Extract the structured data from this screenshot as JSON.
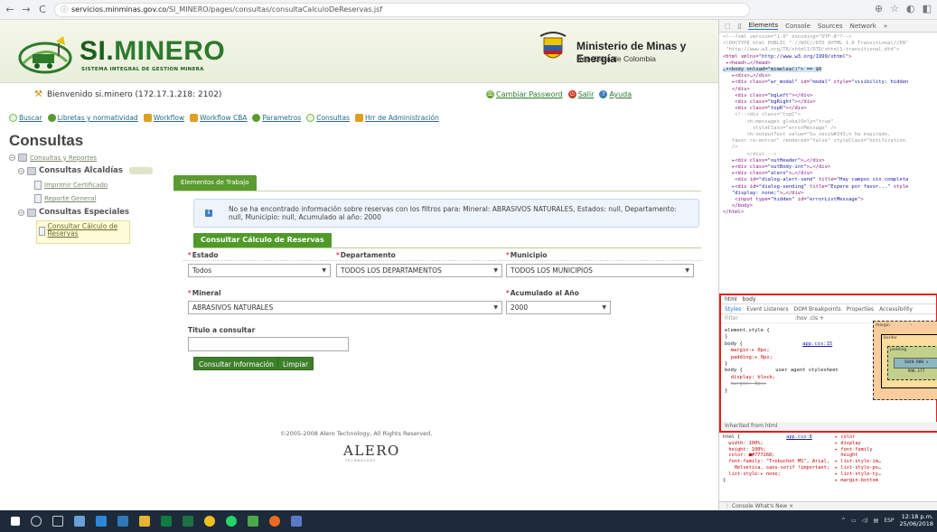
{
  "browser": {
    "url_host": "servicios.minminas.gov.co",
    "url_path": "/SI_MINERO/pages/consultas/consultaCalculoDeReservas.jsf"
  },
  "header": {
    "logo_title_prefix": "SI.",
    "logo_title": "MINERO",
    "logo_subtitle": "SISTEMA INTEGRAL DE GESTION MINERA",
    "ministry": "Ministerio de Minas y Energía",
    "republic": "República de Colombia"
  },
  "welcome": {
    "text": "Bienvenido si.minero (172.17.1.218: 2102)",
    "links": [
      "Cambiar Password",
      "Salir",
      "Ayuda"
    ]
  },
  "menu": {
    "items": [
      "Buscar",
      "Libretas y normatividad",
      "Workflow",
      "Workflow CBA",
      "Parametros",
      "Consultas",
      "Hrr de Administración"
    ]
  },
  "page_title": "Consultas",
  "tree": {
    "root": "Consultas y Reportes",
    "group1": "Consultas Alcaldías",
    "item1": "Imprimir Certificado",
    "item2": "Reporte General",
    "group2": "Consultas Especiales",
    "selected": "Consultar Cálculo de Reservas"
  },
  "tab_label": "Elementos de Trabajo",
  "info_message": "No se ha encontrado información sobre reservas con los filtros para: Mineral: ABRASIVOS NATURALES, Estados: null, Departamento: null, Municipio: null, Acumulado al año: 2000",
  "section_title": "Consultar Cálculo de Reservas",
  "form": {
    "estado_label": "Estado",
    "estado_value": "Todos",
    "departamento_label": "Departamento",
    "departamento_value": "TODOS LOS DEPARTAMENTOS",
    "municipio_label": "Municipio",
    "municipio_value": "TODOS LOS MUNICIPIOS",
    "mineral_label": "Mineral",
    "mineral_value": "ABRASIVOS NATURALES",
    "acumulado_label": "Acumulado al Año",
    "acumulado_value": "2000",
    "titulo_label": "Titulo a consultar",
    "titulo_value": "",
    "required_mark": "*",
    "consultar_button": "Consultar Información",
    "limpiar_button": "Limpiar"
  },
  "footer": {
    "copyright": "©2005-2008 Alero Technology, All Rights Reserved.",
    "logo": "ALERO",
    "logo_sub": "TECHNOLOGY"
  },
  "devtools": {
    "tabs": [
      "Elements",
      "Console",
      "Sources",
      "Network",
      "»"
    ],
    "styles_tabs1": [
      "html",
      "body"
    ],
    "styles_tabs2": [
      "Styles",
      "Event Listeners",
      "DOM Breakpoints",
      "Properties",
      "Accessibility"
    ],
    "filter": "Filter",
    "filter_toggles": ":hov  .cls  +",
    "inherited": "Inherited from html",
    "bottom_tabs": "⋮  Console   What's New ×",
    "box_margin": "margin",
    "box_border": "border",
    "box_padding": "padding",
    "box_content": "1048.800 × 998.177",
    "box_dash": "–"
  },
  "taskbar": {
    "time": "12:18 p.m.",
    "date": "25/06/2018",
    "lang": "ESP"
  }
}
